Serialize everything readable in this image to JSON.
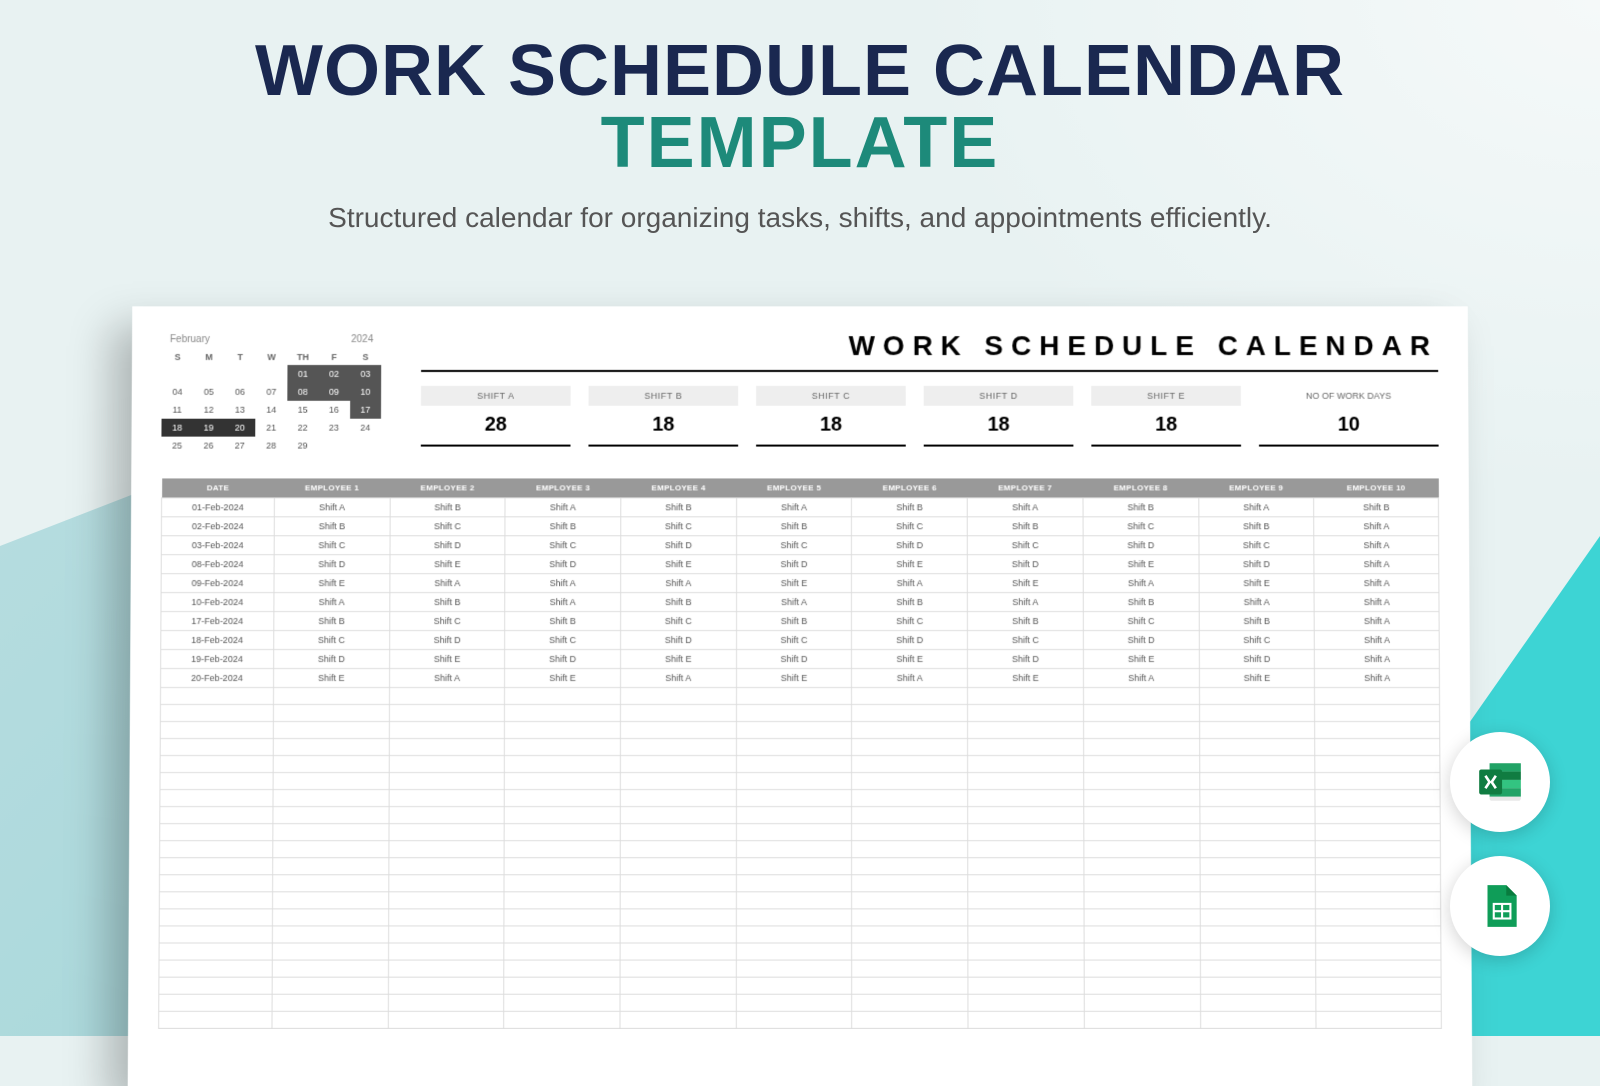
{
  "header": {
    "title_line1": "WORK SCHEDULE CALENDAR",
    "title_line2": "TEMPLATE",
    "subtitle": "Structured calendar for organizing tasks, shifts, and appointments efficiently."
  },
  "mini_calendar": {
    "month": "February",
    "year": "2024",
    "day_headers": [
      "S",
      "M",
      "T",
      "W",
      "TH",
      "F",
      "S"
    ],
    "weeks": [
      [
        {
          "d": ""
        },
        {
          "d": ""
        },
        {
          "d": ""
        },
        {
          "d": ""
        },
        {
          "d": "01",
          "cls": "dark"
        },
        {
          "d": "02",
          "cls": "dark"
        },
        {
          "d": "03",
          "cls": "dark"
        }
      ],
      [
        {
          "d": "04"
        },
        {
          "d": "05"
        },
        {
          "d": "06"
        },
        {
          "d": "07"
        },
        {
          "d": "08",
          "cls": "dark"
        },
        {
          "d": "09",
          "cls": "dark"
        },
        {
          "d": "10",
          "cls": "dark"
        }
      ],
      [
        {
          "d": "11"
        },
        {
          "d": "12"
        },
        {
          "d": "13"
        },
        {
          "d": "14"
        },
        {
          "d": "15"
        },
        {
          "d": "16"
        },
        {
          "d": "17",
          "cls": "dark"
        }
      ],
      [
        {
          "d": "18",
          "cls": "sel"
        },
        {
          "d": "19",
          "cls": "sel"
        },
        {
          "d": "20",
          "cls": "sel"
        },
        {
          "d": "21"
        },
        {
          "d": "22"
        },
        {
          "d": "23"
        },
        {
          "d": "24"
        }
      ],
      [
        {
          "d": "25"
        },
        {
          "d": "26"
        },
        {
          "d": "27"
        },
        {
          "d": "28"
        },
        {
          "d": "29"
        },
        {
          "d": ""
        },
        {
          "d": ""
        }
      ]
    ]
  },
  "sheet": {
    "title": "WORK SCHEDULE CALENDAR",
    "shifts": [
      {
        "label": "SHIFT A",
        "value": "28"
      },
      {
        "label": "SHIFT B",
        "value": "18"
      },
      {
        "label": "SHIFT C",
        "value": "18"
      },
      {
        "label": "SHIFT D",
        "value": "18"
      },
      {
        "label": "SHIFT E",
        "value": "18"
      }
    ],
    "workdays": {
      "label": "NO OF WORK DAYS",
      "value": "10"
    },
    "columns": [
      "DATE",
      "EMPLOYEE 1",
      "EMPLOYEE 2",
      "EMPLOYEE 3",
      "EMPLOYEE 4",
      "EMPLOYEE 5",
      "EMPLOYEE 6",
      "EMPLOYEE 7",
      "EMPLOYEE 8",
      "EMPLOYEE 9",
      "EMPLOYEE 10"
    ],
    "rows": [
      [
        "01-Feb-2024",
        "Shift A",
        "Shift B",
        "Shift A",
        "Shift B",
        "Shift A",
        "Shift B",
        "Shift A",
        "Shift B",
        "Shift A",
        "Shift B"
      ],
      [
        "02-Feb-2024",
        "Shift B",
        "Shift C",
        "Shift B",
        "Shift C",
        "Shift B",
        "Shift C",
        "Shift B",
        "Shift C",
        "Shift B",
        "Shift A"
      ],
      [
        "03-Feb-2024",
        "Shift C",
        "Shift D",
        "Shift C",
        "Shift D",
        "Shift C",
        "Shift D",
        "Shift C",
        "Shift D",
        "Shift C",
        "Shift A"
      ],
      [
        "08-Feb-2024",
        "Shift D",
        "Shift E",
        "Shift D",
        "Shift E",
        "Shift D",
        "Shift E",
        "Shift D",
        "Shift E",
        "Shift D",
        "Shift A"
      ],
      [
        "09-Feb-2024",
        "Shift E",
        "Shift A",
        "Shift A",
        "Shift A",
        "Shift E",
        "Shift A",
        "Shift E",
        "Shift A",
        "Shift E",
        "Shift A"
      ],
      [
        "10-Feb-2024",
        "Shift A",
        "Shift B",
        "Shift A",
        "Shift B",
        "Shift A",
        "Shift B",
        "Shift A",
        "Shift B",
        "Shift A",
        "Shift A"
      ],
      [
        "17-Feb-2024",
        "Shift B",
        "Shift C",
        "Shift B",
        "Shift C",
        "Shift B",
        "Shift C",
        "Shift B",
        "Shift C",
        "Shift B",
        "Shift A"
      ],
      [
        "18-Feb-2024",
        "Shift C",
        "Shift D",
        "Shift C",
        "Shift D",
        "Shift C",
        "Shift D",
        "Shift C",
        "Shift D",
        "Shift C",
        "Shift A"
      ],
      [
        "19-Feb-2024",
        "Shift D",
        "Shift E",
        "Shift D",
        "Shift E",
        "Shift D",
        "Shift E",
        "Shift D",
        "Shift E",
        "Shift D",
        "Shift A"
      ],
      [
        "20-Feb-2024",
        "Shift E",
        "Shift A",
        "Shift E",
        "Shift A",
        "Shift E",
        "Shift A",
        "Shift E",
        "Shift A",
        "Shift E",
        "Shift A"
      ]
    ],
    "empty_rows": 20
  }
}
